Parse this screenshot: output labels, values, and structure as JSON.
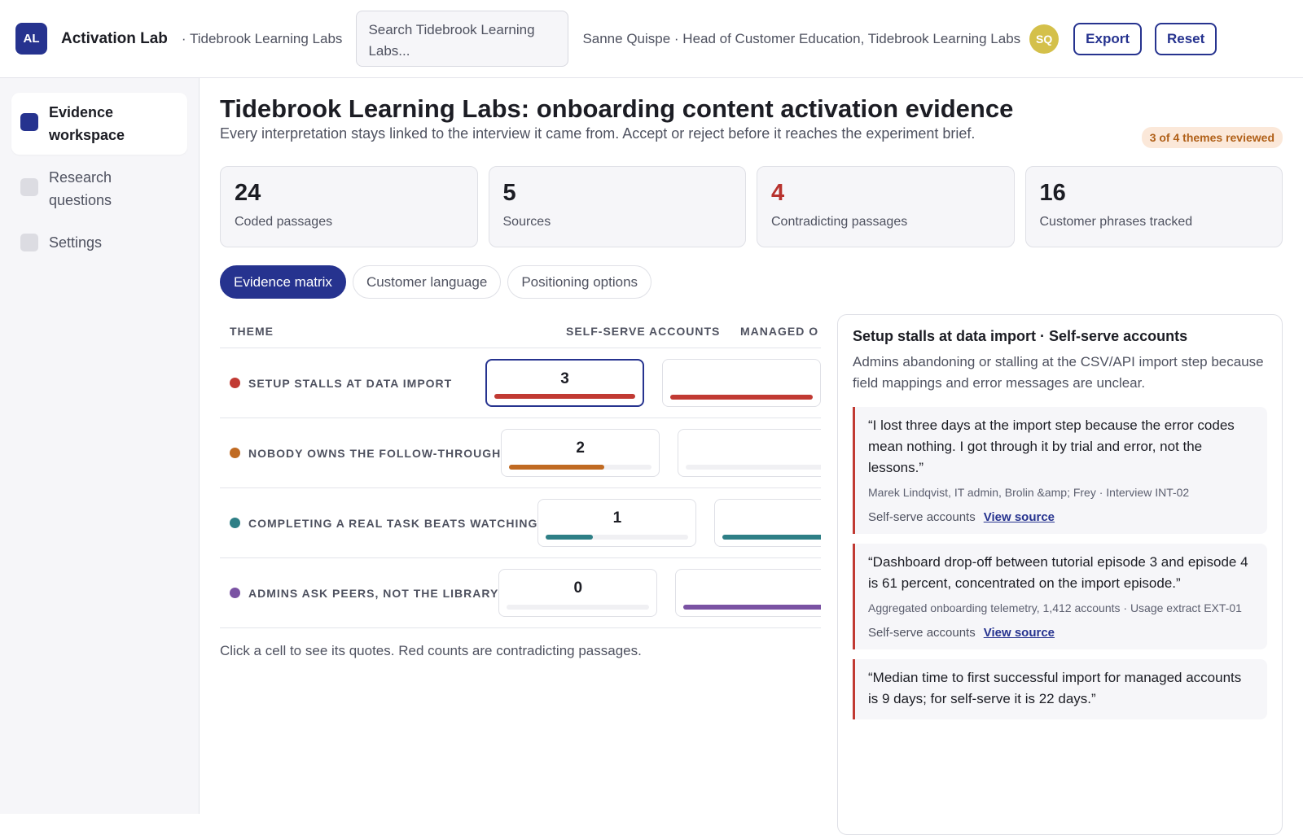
{
  "topbar": {
    "logo": "AL",
    "app_name": "Activation Lab",
    "org": "· Tidebrook Learning Labs",
    "search_placeholder": "Search Tidebrook Learning Labs...",
    "user": "Sanne Quispe · Head of Customer Education, Tidebrook Learning Labs",
    "avatar": "SQ",
    "export_label": "Export",
    "reset_label": "Reset"
  },
  "sidebar": {
    "items": [
      {
        "label": "Evidence workspace",
        "active": true
      },
      {
        "label": "Research questions",
        "active": false
      },
      {
        "label": "Settings",
        "active": false
      }
    ]
  },
  "page": {
    "title": "Tidebrook Learning Labs: onboarding content activation evidence",
    "subtitle": "Every interpretation stays linked to the interview it came from. Accept or reject before it reaches the experiment brief.",
    "review_badge": "3 of 4 themes reviewed"
  },
  "stats": [
    {
      "value": "24",
      "label": "Coded passages"
    },
    {
      "value": "5",
      "label": "Sources"
    },
    {
      "value": "4",
      "label": "Contradicting passages"
    },
    {
      "value": "16",
      "label": "Customer phrases tracked"
    }
  ],
  "tabs": [
    {
      "label": "Evidence matrix",
      "active": true
    },
    {
      "label": "Customer language",
      "active": false
    },
    {
      "label": "Positioning options",
      "active": false
    }
  ],
  "matrix": {
    "headers": {
      "theme": "THEME",
      "col_a": "SELF-SERVE ACCOUNTS",
      "col_b": "MANAGED O"
    },
    "rows": [
      {
        "theme": "SETUP STALLS AT DATA IMPORT",
        "color": "#c13a33",
        "count_a": "3",
        "fill_a": 1.0,
        "fill_b": 1.0
      },
      {
        "theme": "NOBODY OWNS THE FOLLOW-THROUGH",
        "color": "#c06a22",
        "count_a": "2",
        "fill_a": 0.67,
        "fill_b": 0.0
      },
      {
        "theme": "COMPLETING A REAL TASK BEATS WATCHING",
        "color": "#2e7f86",
        "count_a": "1",
        "fill_a": 0.33,
        "fill_b": 1.0
      },
      {
        "theme": "ADMINS ASK PEERS, NOT THE LIBRARY",
        "color": "#7a52a3",
        "count_a": "0",
        "fill_a": 0.0,
        "fill_b": 1.0
      }
    ],
    "note": "Click a cell to see its quotes. Red counts are contradicting passages."
  },
  "detail": {
    "title": "Setup stalls at data import · Self-serve accounts",
    "description": "Admins abandoning or stalling at the CSV/API import step because field mappings and error messages are unclear.",
    "quotes": [
      {
        "text": "“I lost three days at the import step because the error codes mean nothing. I got through it by trial and error, not the lessons.”",
        "source": "Marek Lindqvist, IT admin, Brolin &amp; Frey · Interview INT-02",
        "segment": "Self-serve accounts",
        "link": "View source"
      },
      {
        "text": "“Dashboard drop-off between tutorial episode 3 and episode 4 is 61 percent, concentrated on the import episode.”",
        "source": "Aggregated onboarding telemetry, 1,412 accounts · Usage extract EXT-01",
        "segment": "Self-serve accounts",
        "link": "View source"
      },
      {
        "text": "“Median time to first successful import for managed accounts is 9 days; for self-serve it is 22 days.”",
        "source": "",
        "segment": "",
        "link": ""
      }
    ]
  },
  "colors": {
    "accent": "#26338f",
    "contradict": "#b8332f"
  }
}
